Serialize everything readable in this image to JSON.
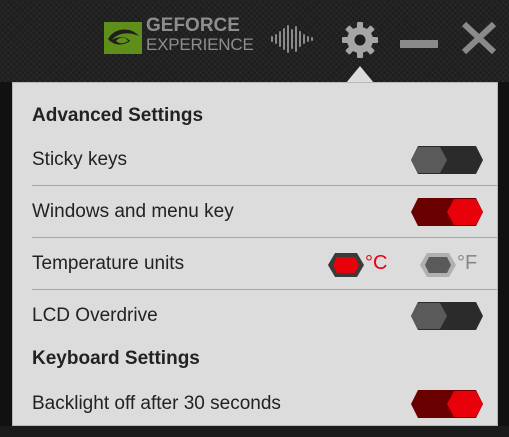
{
  "titlebar": {
    "logo_line1": "GEFORCE",
    "logo_line2": "EXPERIENCE",
    "logo_icon": "nvidia-eye-icon",
    "icons": [
      "equalizer-icon",
      "gear-icon",
      "minimize-icon",
      "close-icon"
    ]
  },
  "panel": {
    "advanced_heading": "Advanced Settings",
    "sticky_keys": {
      "label": "Sticky keys",
      "enabled": false
    },
    "windows_key": {
      "label": "Windows and menu key",
      "enabled": true
    },
    "temperature": {
      "label": "Temperature units",
      "celsius": "°C",
      "fahrenheit": "°F",
      "selected": "celsius"
    },
    "lcd_overdrive": {
      "label": "LCD Overdrive",
      "enabled": false
    },
    "keyboard_heading": "Keyboard Settings",
    "backlight": {
      "label": "Backlight off after 30 seconds",
      "enabled": true
    }
  },
  "colors": {
    "accent_red": "#e8000b",
    "toggle_off": "#3a3a3a",
    "panel_bg": "#dcdcdc",
    "titlebar_bg": "#1e1e1e"
  }
}
